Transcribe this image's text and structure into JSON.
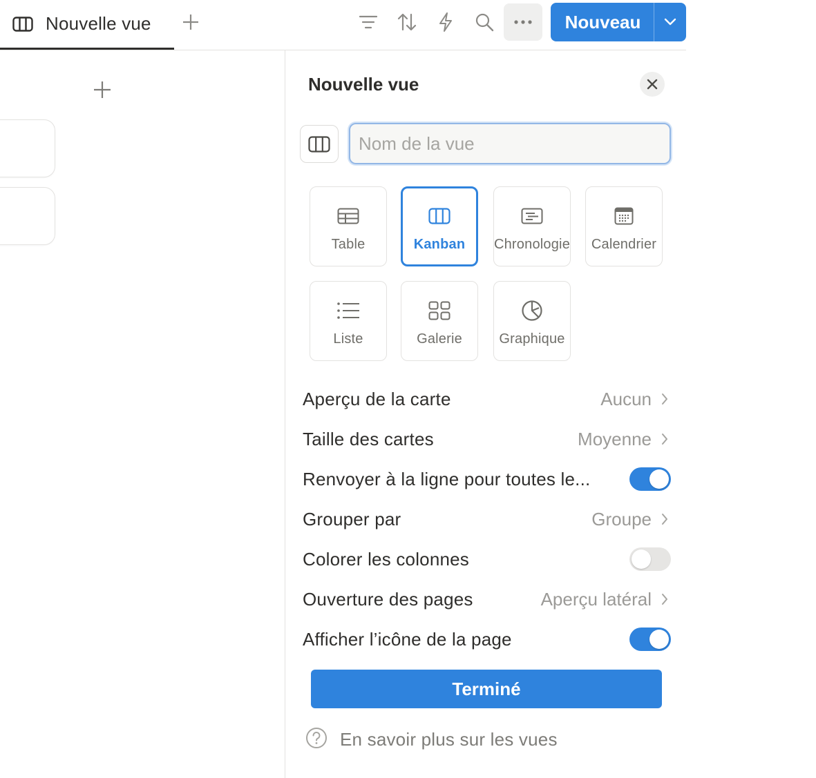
{
  "topbar": {
    "active_view": "Nouvelle vue",
    "new_button_label": "Nouveau"
  },
  "panel": {
    "title": "Nouvelle vue",
    "name_placeholder": "Nom de la vue",
    "name_value": "",
    "layouts": [
      {
        "label": "Table",
        "icon": "table-icon",
        "selected": false
      },
      {
        "label": "Kanban",
        "icon": "board-icon",
        "selected": true
      },
      {
        "label": "Chronologie",
        "icon": "timeline-icon",
        "selected": false
      },
      {
        "label": "Calendrier",
        "icon": "calendar-icon",
        "selected": false
      },
      {
        "label": "Liste",
        "icon": "list-icon",
        "selected": false
      },
      {
        "label": "Galerie",
        "icon": "gallery-icon",
        "selected": false
      },
      {
        "label": "Graphique",
        "icon": "chart-icon",
        "selected": false
      }
    ],
    "settings": [
      {
        "label": "Aperçu de la carte",
        "value": "Aucun",
        "type": "select"
      },
      {
        "label": "Taille des cartes",
        "value": "Moyenne",
        "type": "select"
      },
      {
        "label": "Renvoyer à la ligne pour toutes le...",
        "type": "toggle",
        "on": true
      },
      {
        "label": "Grouper par",
        "value": "Groupe",
        "type": "select"
      },
      {
        "label": "Colorer les colonnes",
        "type": "toggle",
        "on": false
      },
      {
        "label": "Ouverture des pages",
        "value": "Aperçu latéral",
        "type": "select"
      },
      {
        "label": "Afficher l’icône de la page",
        "type": "toggle",
        "on": true
      }
    ],
    "done_label": "Terminé",
    "help_label": "En savoir plus sur les vues"
  },
  "colors": {
    "accent": "#2f83dd",
    "text": "#37352f",
    "muted": "#9b9a97",
    "border": "#e3e2e0"
  }
}
